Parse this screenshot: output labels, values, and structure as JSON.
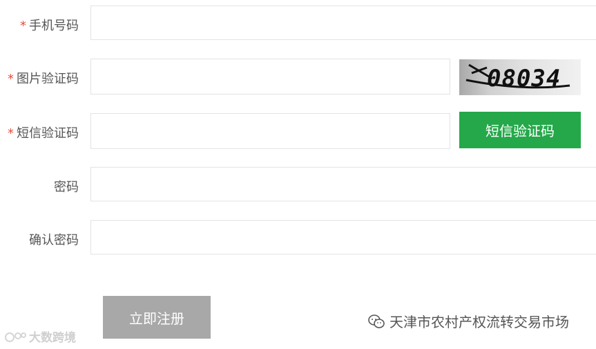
{
  "form": {
    "phone": {
      "required_mark": "*",
      "label": "手机号码",
      "value": ""
    },
    "image_code": {
      "required_mark": "*",
      "label": "图片验证码",
      "value": "",
      "captcha_text": "08034"
    },
    "sms_code": {
      "required_mark": "*",
      "label": "短信验证码",
      "value": "",
      "button_label": "短信验证码"
    },
    "password": {
      "label": "密码",
      "value": ""
    },
    "confirm_password": {
      "label": "确认密码",
      "value": ""
    },
    "submit_label": "立即注册"
  },
  "watermarks": {
    "left_text": "大数跨境",
    "right_text": "天津市农村产权流转交易市场",
    "right_icon": "wechat-icon",
    "left_icon": "logo-icon"
  },
  "colors": {
    "required": "#e84c3d",
    "sms_button": "#25a84a",
    "submit_button": "#a8a8a8",
    "input_border": "#e3e3e3"
  }
}
